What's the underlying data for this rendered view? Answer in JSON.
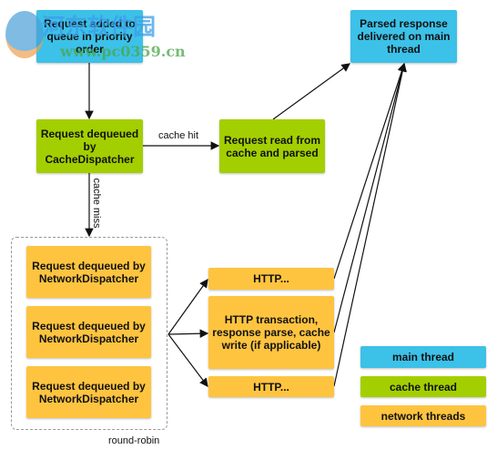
{
  "nodes": {
    "queued": "Request added to queue in priority order",
    "cache_dequeue": "Request dequeued by CacheDispatcher",
    "cache_read": "Request read from cache and parsed",
    "delivered": "Parsed response delivered on main thread",
    "net1": "Request dequeued by NetworkDispatcher",
    "net2": "Request dequeued by NetworkDispatcher",
    "net3": "Request dequeued by NetworkDispatcher",
    "http1": "HTTP...",
    "http2": "HTTP transaction, response parse, cache write (if applicable)",
    "http3": "HTTP..."
  },
  "edge_labels": {
    "cache_hit": "cache hit",
    "cache_miss": "cache miss",
    "round_robin": "round-robin"
  },
  "legend": [
    {
      "label": "main thread",
      "color": "#3cc1e8"
    },
    {
      "label": "cache thread",
      "color": "#a3cf00"
    },
    {
      "label": "network threads",
      "color": "#fec440"
    }
  ],
  "watermark": {
    "title": "河东软件园",
    "url": "www.pc0359.cn"
  }
}
